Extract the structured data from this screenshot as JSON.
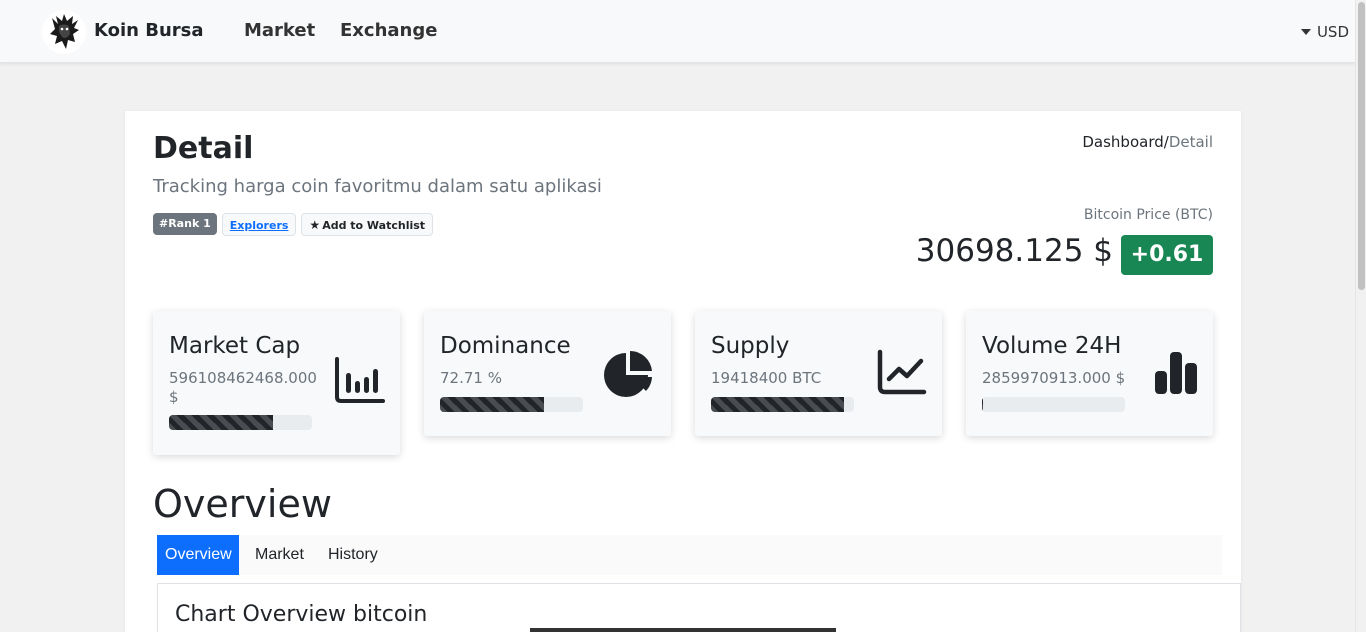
{
  "navbar": {
    "brand": "Koin Bursa",
    "links": [
      "Market",
      "Exchange"
    ],
    "currency": "USD"
  },
  "header": {
    "title": "Detail",
    "subtitle": "Tracking harga coin favoritmu dalam satu aplikasi",
    "breadcrumb": {
      "parent": "Dashboard",
      "separator": "/",
      "current": "Detail"
    }
  },
  "badges": {
    "rank": "#Rank 1",
    "explorers": "Explorers",
    "watchlist": "Add to Watchlist"
  },
  "price": {
    "label": "Bitcoin Price (BTC)",
    "value": "30698.125 $",
    "change": "+0.61",
    "change_color": "#198754"
  },
  "stats": [
    {
      "title": "Market Cap",
      "value": "596108462468.000 $",
      "progress": 0.73,
      "icon": "chart-bar-axis-icon"
    },
    {
      "title": "Dominance",
      "value": "72.71 %",
      "progress": 0.7271,
      "icon": "chart-pie-icon"
    },
    {
      "title": "Supply",
      "value": "19418400 BTC",
      "progress": 0.93,
      "icon": "chart-line-icon"
    },
    {
      "title": "Volume 24H",
      "value": "2859970913.000 $",
      "progress": 0.01,
      "icon": "chart-simple-icon"
    }
  ],
  "overview": {
    "title": "Overview",
    "tabs": [
      "Overview",
      "Market",
      "History"
    ],
    "active_tab": "Overview",
    "chart_title": "Chart Overview bitcoin"
  },
  "colors": {
    "primary": "#0d6efd",
    "success": "#198754",
    "dark": "#212529"
  }
}
